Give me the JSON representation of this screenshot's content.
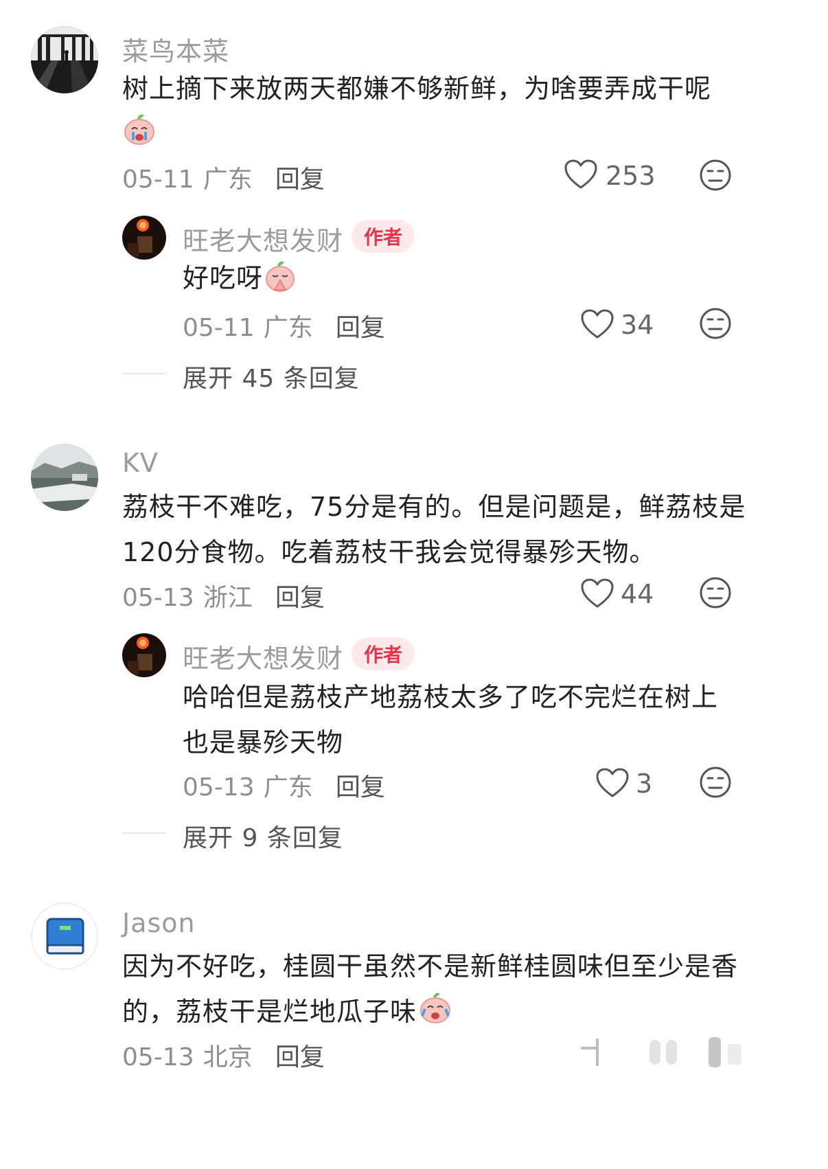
{
  "comments": [
    {
      "username": "菜鸟本菜",
      "text": "树上摘下来放两天都嫌不够新鲜，为啥要弄成干呢",
      "date": "05-11",
      "location": "广东",
      "reply_label": "回复",
      "likes": "253",
      "reply": {
        "username": "旺老大想发财",
        "badge": "作者",
        "text": "好吃呀",
        "date": "05-11",
        "location": "广东",
        "reply_label": "回复",
        "likes": "34"
      },
      "expand_label": "展开 45 条回复"
    },
    {
      "username": "KV",
      "text_line1": "荔枝干不难吃，75分是有的。但是问题是，鲜荔枝是",
      "text_line2": "120分食物。吃着荔枝干我会觉得暴殄天物。",
      "date": "05-13",
      "location": "浙江",
      "reply_label": "回复",
      "likes": "44",
      "reply": {
        "username": "旺老大想发财",
        "badge": "作者",
        "text_line1": "哈哈但是荔枝产地荔枝太多了吃不完烂在树上",
        "text_line2": "也是暴殄天物",
        "date": "05-13",
        "location": "广东",
        "reply_label": "回复",
        "likes": "3"
      },
      "expand_label": "展开 9 条回复"
    },
    {
      "username": "Jason",
      "text_line1": "因为不好吃，桂圆干虽然不是新鲜桂圆味但至少是香",
      "text_line2": "的，荔枝干是烂地瓜子味",
      "date": "05-13",
      "location": "北京",
      "reply_label": "回复"
    }
  ],
  "icons": {
    "like": "heart-outline-icon",
    "dislike": "neutral-face-icon"
  },
  "colors": {
    "author_badge_bg": "#fde8ea",
    "author_badge_text": "#e8334a",
    "username": "#9b9b9b"
  }
}
